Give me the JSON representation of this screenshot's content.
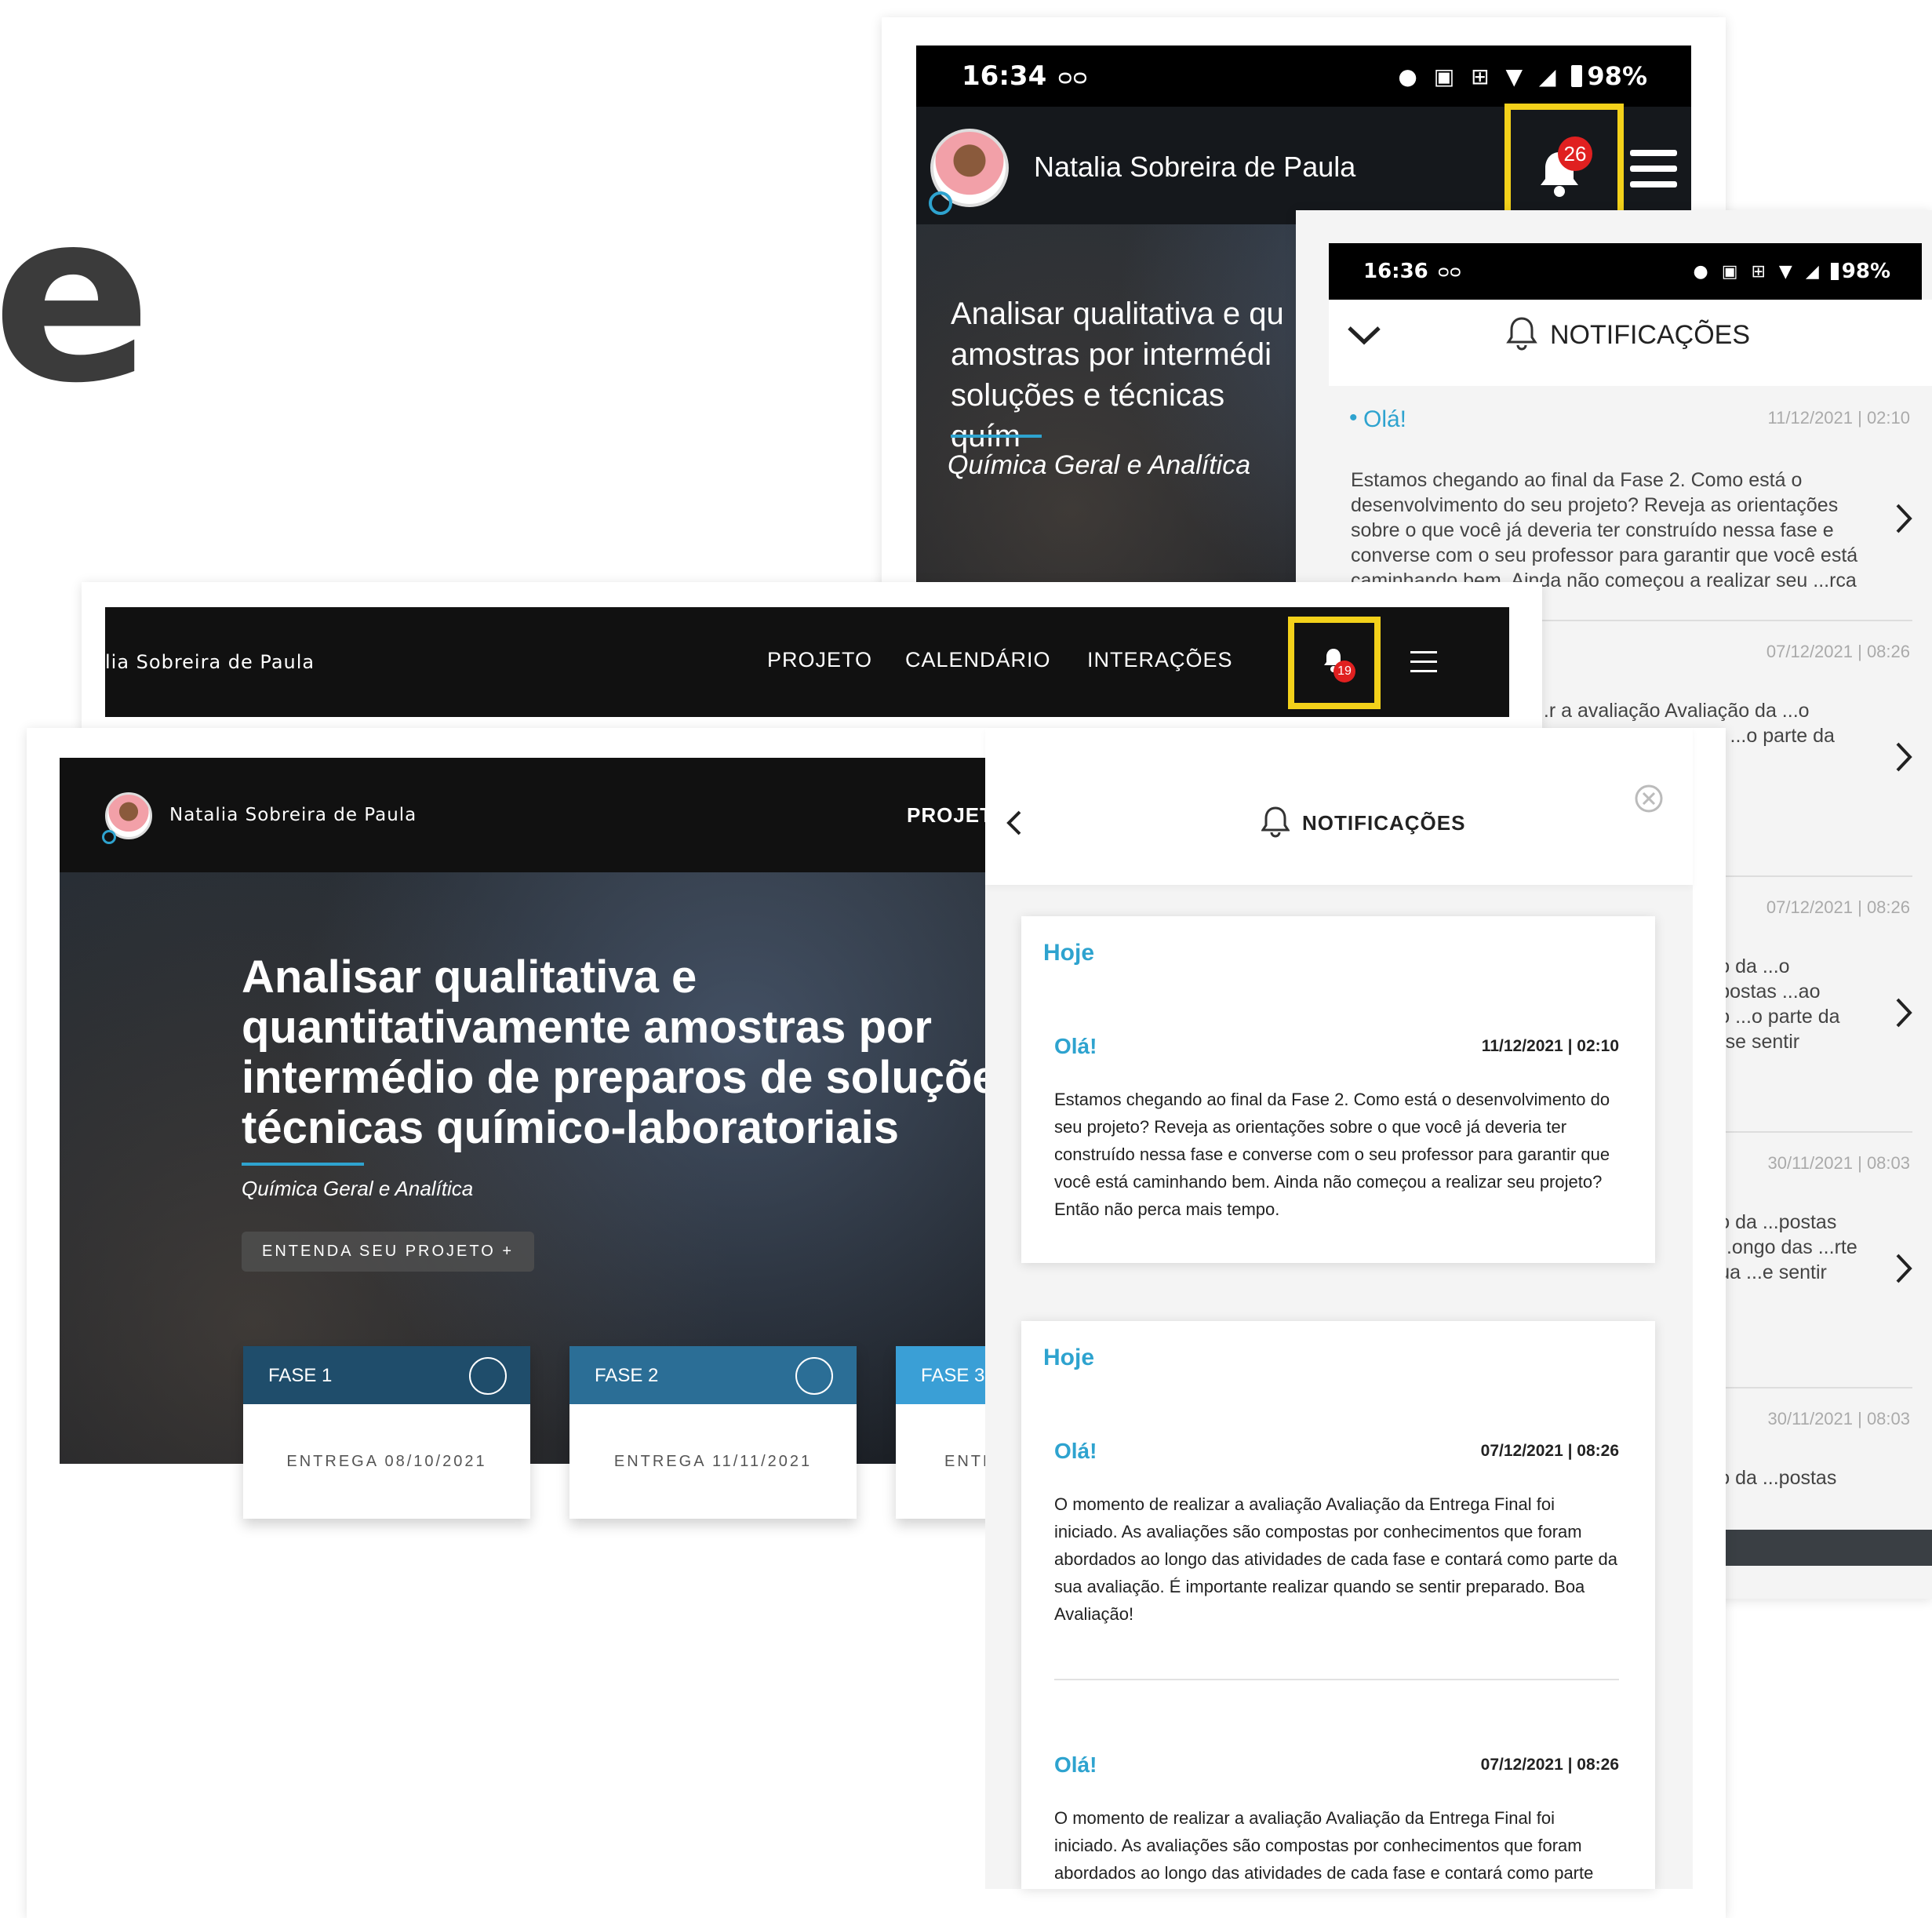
{
  "decor_letter": "e",
  "colors": {
    "accent": "#2ea3cf",
    "highlight": "#f3d11a",
    "badge": "#e02020",
    "phase_blue": "#1f4d6b"
  },
  "mobile1": {
    "status": {
      "time": "16:34",
      "icons": "• ◈ ᵛᵒˡᵗᵉ ▾ ⁴ᴳ◢",
      "battery": "98%"
    },
    "user_name": "Natalia Sobreira de Paula",
    "badge_count": "26",
    "hero_title": "Analisar qualitativa e qu amostras por intermédi soluções e técnicas quím",
    "hero_subtitle": "Química Geral e Analítica"
  },
  "mobile2": {
    "status": {
      "time": "16:36",
      "battery": "98%"
    },
    "title": "NOTIFICAÇÕES",
    "items": [
      {
        "title": "Olá!",
        "date": "11/12/2021 | 02:10",
        "text": "Estamos chegando ao final da Fase 2. Como está o desenvolvimento do seu projeto? Reveja as orientações sobre o que você já deveria ter construído nessa fase e converse com o seu professor para garantir que você está caminhando bem. Ainda não começou a realizar seu ...rca mais tempo."
      },
      {
        "title": "",
        "date": "07/12/2021 | 08:26",
        "text": "...r a avaliação Avaliação da ...o compostas ...ao longo ...o parte da ...do se sentir"
      },
      {
        "title": "",
        "date": "07/12/2021 | 08:26",
        "text": "...ção da ...o compostas ...ao longo ...o parte da ...do se sentir"
      },
      {
        "title": "",
        "date": "30/11/2021 | 08:03",
        "text": "...ção da ...postas por ...ongo das ...rte da sua ...e sentir"
      },
      {
        "title": "",
        "date": "30/11/2021 | 08:03",
        "text": "...ção da ...postas por"
      }
    ]
  },
  "navbar": {
    "user_name": "lia Sobreira de Paula",
    "links": [
      "PROJETO",
      "CALENDÁRIO",
      "INTERAÇÕES"
    ],
    "badge_count": "19"
  },
  "desktop": {
    "user_name": "Natalia Sobreira de Paula",
    "nav_partial": "PROJET",
    "hero_title": [
      "Analisar qualitativa e",
      "quantitativamente amostras por",
      "intermédio de preparos de soluções",
      "técnicas químico-laboratoriais"
    ],
    "hero_subtitle": "Química Geral e Analítica",
    "cta": "ENTENDA SEU PROJETO +",
    "phases": [
      {
        "label": "FASE 1",
        "delivery": "ENTREGA 08/10/2021"
      },
      {
        "label": "FASE 2",
        "delivery": "ENTREGA 11/11/2021"
      },
      {
        "label": "FASE 3",
        "delivery": "ENTR"
      }
    ]
  },
  "panel": {
    "title": "NOTIFICAÇÕES",
    "groups": [
      {
        "heading": "Hoje",
        "items": [
          {
            "title": "Olá!",
            "date": "11/12/2021 | 02:10",
            "text": "Estamos chegando ao final da Fase 2. Como está o desenvolvimento do seu projeto? Reveja as orientações sobre o que você já deveria ter construído nessa fase e converse com o seu professor para garantir que você está caminhando bem. Ainda não começou a realizar seu projeto? Então não perca mais tempo."
          }
        ]
      },
      {
        "heading": "Hoje",
        "items": [
          {
            "title": "Olá!",
            "date": "07/12/2021 | 08:26",
            "text": "O momento de realizar a avaliação Avaliação da Entrega Final foi iniciado. As avaliações são compostas por conhecimentos que foram abordados ao longo das atividades de cada fase e contará como parte da sua avaliação. É importante realizar quando se sentir preparado. Boa Avaliação!"
          },
          {
            "title": "Olá!",
            "date": "07/12/2021 | 08:26",
            "text": "O momento de realizar a avaliação Avaliação da Entrega Final foi iniciado. As avaliações são compostas por conhecimentos que foram abordados ao longo das atividades de cada fase e contará como parte"
          }
        ]
      }
    ]
  }
}
